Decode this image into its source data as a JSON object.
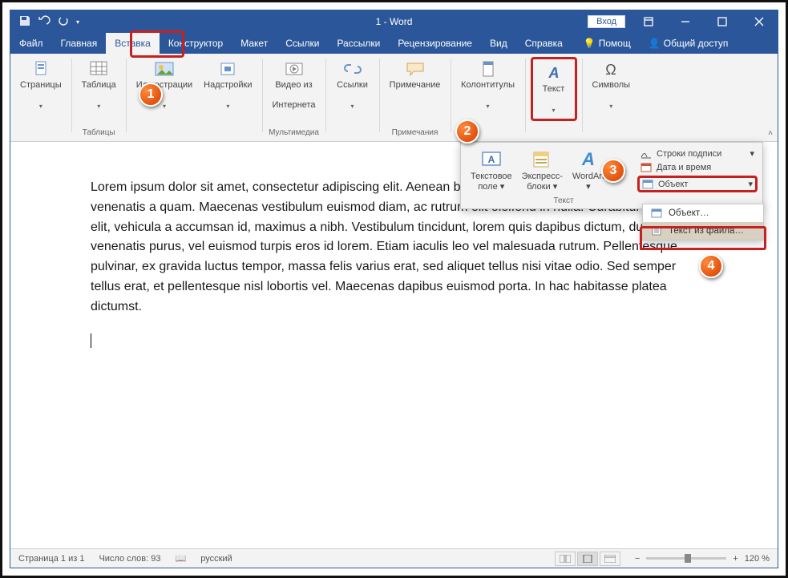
{
  "window": {
    "title": "1 - Word",
    "signin": "Вход"
  },
  "tabs": {
    "file": "Файл",
    "home": "Главная",
    "insert": "Вставка",
    "design": "Конструктор",
    "layout": "Макет",
    "references": "Ссылки",
    "mailings": "Рассылки",
    "review": "Рецензирование",
    "view": "Вид",
    "help": "Справка",
    "tell_me": "Помощ",
    "share": "Общий доступ"
  },
  "ribbon": {
    "pages": "Страницы",
    "table": "Таблица",
    "tables_group": "Таблицы",
    "illustrations": "Иллюстрации",
    "addins": "Надстройки",
    "online_video_l1": "Видео из",
    "online_video_l2": "Интернета",
    "media_group": "Мультимедиа",
    "links": "Ссылки",
    "comment": "Примечание",
    "comments_group": "Примечания",
    "header_footer": "Колонтитулы",
    "text": "Текст",
    "symbols": "Символы"
  },
  "popout": {
    "textbox_l1": "Текстовое",
    "textbox_l2": "поле",
    "quickparts_l1": "Экспресс-",
    "quickparts_l2": "блоки",
    "wordart": "WordArt",
    "sig_line": "Строки подписи",
    "date_time": "Дата и время",
    "object_btn": "Объект",
    "group_label": "Текст",
    "menu_object": "Объект…",
    "menu_text_from_file": "Текст из файла…"
  },
  "badges": {
    "b1": "1",
    "b2": "2",
    "b3": "3",
    "b4": "4"
  },
  "document": {
    "text": "Lorem ipsum dolor sit amet, consectetur adipiscing elit. Aenean bibendum arcu ut nunc aliquam nec, venenatis a quam. Maecenas vestibulum euismod diam, ac rutrum elit eleifend in nulla. Curabitur augue elit, vehicula a accumsan id, maximus a nibh. Vestibulum tincidunt, lorem quis dapibus dictum, dui lorem venenatis purus, vel euismod turpis eros id lorem. Etiam iaculis leo vel malesuada rutrum. Pellentesque pulvinar, ex gravida luctus tempor, massa felis varius erat, sed aliquet tellus nisi vitae odio. Sed semper tellus erat, et pellentesque nisl lobortis vel. Maecenas dapibus euismod porta. In hac habitasse platea dictumst."
  },
  "status": {
    "page": "Страница 1 из 1",
    "words": "Число слов: 93",
    "lang": "русский",
    "zoom": "120 %"
  }
}
